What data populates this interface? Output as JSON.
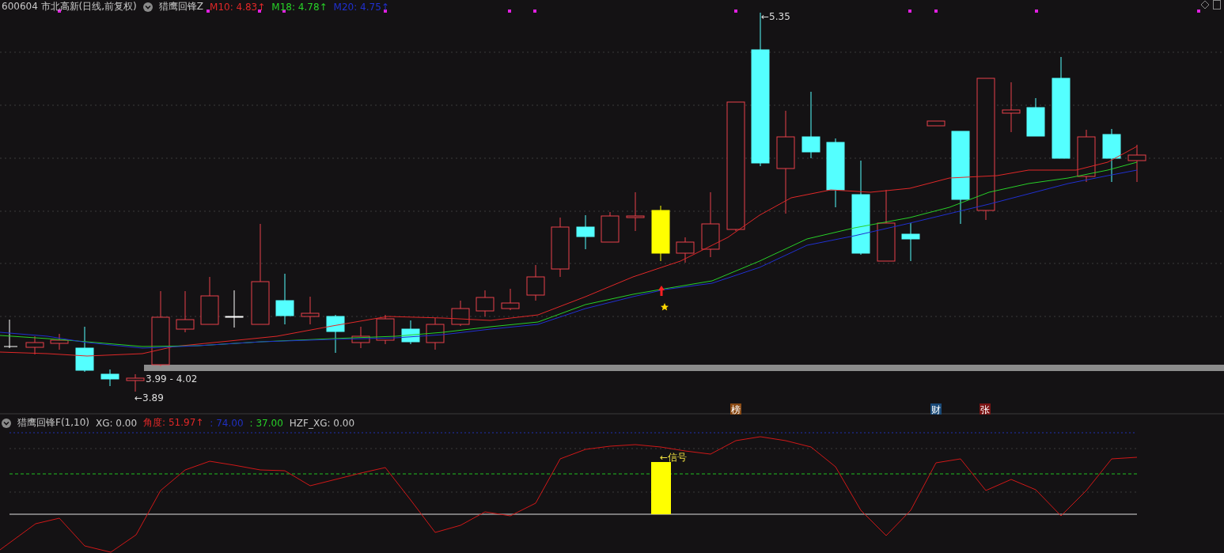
{
  "main_panel": {
    "header": {
      "symbol": "600604 市北高新(日线,前复权)",
      "indicator": "猎鹰回锋Z",
      "ma_values": [
        {
          "label": "M10: 4.83↑",
          "color": "#e02828"
        },
        {
          "label": "M18: 4.78↑",
          "color": "#28d028"
        },
        {
          "label": "M20: 4.75↑",
          "color": "#2030d0"
        }
      ]
    },
    "price_labels": {
      "high": "←5.35",
      "range": "3.99 - 4.02",
      "low": "←3.89"
    },
    "event_badges": [
      {
        "label": "榜",
        "color": "#8a4a14"
      },
      {
        "label": "财",
        "color": "#1a4a78"
      },
      {
        "label": "张",
        "color": "#7a1414"
      }
    ]
  },
  "indicator_panel": {
    "header": {
      "name": "猎鹰回锋F(1,10)",
      "values": [
        {
          "text": "XG: 0.00",
          "color": "#c8c8c8"
        },
        {
          "text": "角度: 51.97↑",
          "color": "#e02828"
        },
        {
          "text": ": 74.00",
          "color": "#2030c0"
        },
        {
          "text": ": 37.00",
          "color": "#28d028"
        },
        {
          "text": "HZF_XG: 0.00",
          "color": "#c8c8c8"
        }
      ]
    },
    "signal_label": "←信号"
  }
}
